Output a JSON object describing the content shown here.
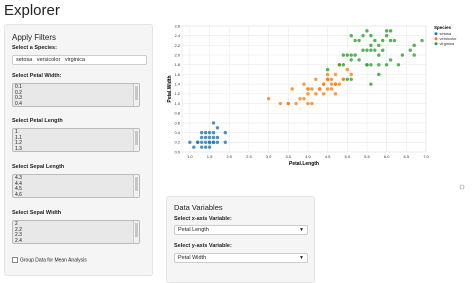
{
  "app": {
    "title": "Explorer"
  },
  "filters": {
    "heading": "Apply Filters",
    "species_label": "Select a Species:",
    "species_values": [
      "setosa",
      "versicolor",
      "virginica"
    ],
    "petal_width_label": "Select Petal Width:",
    "petal_width_options": [
      "0.1",
      "0.2",
      "0.3",
      "0.4"
    ],
    "petal_length_label": "Select Petal Length",
    "petal_length_options": [
      "1",
      "1.1",
      "1.2",
      "1.3"
    ],
    "sepal_length_label": "Select Sepal Length",
    "sepal_length_options": [
      "4.3",
      "4.4",
      "4.5",
      "4.6"
    ],
    "sepal_width_label": "Select Sepal Width",
    "sepal_width_options": [
      "2",
      "2.2",
      "2.3",
      "2.4"
    ],
    "group_checkbox_label": "Group Data for Mean Analysis"
  },
  "variables": {
    "heading": "Data Variables",
    "x_label": "Select x-axis Variable:",
    "x_value": "Petal Length",
    "y_label": "Select y-axis Variable:",
    "y_value": "Petal Width"
  },
  "colors": {
    "setosa": "#1f77b4",
    "versicolor": "#ff7f0e",
    "virginica": "#2ca02c"
  },
  "chart_data": {
    "type": "scatter",
    "xlabel": "Petal.Length",
    "ylabel": "Petal.Width",
    "xlim": [
      0.8,
      7.0
    ],
    "ylim": [
      0,
      2.6
    ],
    "x_ticks": [
      "1.0",
      "1.5",
      "2.0",
      "2.5",
      "3.0",
      "3.5",
      "4.0",
      "4.5",
      "5.0",
      "5.5",
      "6.0",
      "6.5",
      "7.0"
    ],
    "y_ticks": [
      "0.0",
      "0.2",
      "0.4",
      "0.6",
      "0.8",
      "1.0",
      "1.2",
      "1.4",
      "1.6",
      "1.8",
      "2.0",
      "2.2",
      "2.4",
      "2.6"
    ],
    "legend_title": "Species",
    "legend_position": "top-right",
    "series": [
      {
        "name": "setosa",
        "points": [
          [
            1.4,
            0.2
          ],
          [
            1.3,
            0.2
          ],
          [
            1.5,
            0.2
          ],
          [
            1.6,
            0.2
          ],
          [
            1.7,
            0.2
          ],
          [
            1.2,
            0.2
          ],
          [
            1.1,
            0.1
          ],
          [
            1.4,
            0.1
          ],
          [
            1.5,
            0.1
          ],
          [
            1.5,
            0.4
          ],
          [
            1.3,
            0.4
          ],
          [
            1.7,
            0.3
          ],
          [
            1.4,
            0.3
          ],
          [
            1.3,
            0.3
          ],
          [
            1.0,
            0.2
          ],
          [
            1.9,
            0.2
          ],
          [
            1.6,
            0.4
          ],
          [
            1.5,
            0.3
          ],
          [
            1.6,
            0.6
          ],
          [
            1.9,
            0.4
          ],
          [
            1.6,
            0.2
          ],
          [
            1.4,
            0.4
          ],
          [
            1.2,
            0.2
          ],
          [
            1.5,
            0.2
          ],
          [
            1.3,
            0.1
          ],
          [
            1.6,
            0.3
          ],
          [
            1.7,
            0.5
          ]
        ]
      },
      {
        "name": "versicolor",
        "points": [
          [
            4.7,
            1.4
          ],
          [
            4.5,
            1.5
          ],
          [
            4.9,
            1.5
          ],
          [
            4.0,
            1.3
          ],
          [
            4.6,
            1.5
          ],
          [
            4.5,
            1.3
          ],
          [
            4.7,
            1.6
          ],
          [
            3.3,
            1.0
          ],
          [
            4.6,
            1.3
          ],
          [
            3.9,
            1.4
          ],
          [
            3.5,
            1.0
          ],
          [
            4.2,
            1.5
          ],
          [
            4.0,
            1.0
          ],
          [
            4.7,
            1.4
          ],
          [
            3.6,
            1.3
          ],
          [
            4.4,
            1.4
          ],
          [
            4.5,
            1.5
          ],
          [
            4.1,
            1.0
          ],
          [
            4.5,
            1.5
          ],
          [
            3.9,
            1.1
          ],
          [
            4.8,
            1.8
          ],
          [
            4.0,
            1.3
          ],
          [
            4.9,
            1.5
          ],
          [
            4.7,
            1.2
          ],
          [
            4.3,
            1.3
          ],
          [
            4.4,
            1.4
          ],
          [
            4.8,
            1.4
          ],
          [
            5.0,
            1.7
          ],
          [
            3.8,
            1.1
          ],
          [
            3.7,
            1.0
          ],
          [
            5.1,
            1.6
          ],
          [
            4.5,
            1.6
          ],
          [
            4.1,
            1.3
          ],
          [
            3.0,
            1.1
          ],
          [
            4.2,
            1.2
          ],
          [
            4.4,
            1.2
          ],
          [
            4.6,
            1.4
          ],
          [
            4.0,
            1.2
          ],
          [
            3.5,
            1.0
          ],
          [
            4.3,
            1.3
          ]
        ]
      },
      {
        "name": "virginica",
        "points": [
          [
            6.0,
            2.5
          ],
          [
            5.1,
            1.9
          ],
          [
            5.9,
            2.1
          ],
          [
            5.6,
            1.8
          ],
          [
            5.8,
            2.2
          ],
          [
            6.6,
            2.1
          ],
          [
            4.5,
            1.7
          ],
          [
            6.3,
            1.8
          ],
          [
            6.1,
            2.5
          ],
          [
            5.1,
            2.0
          ],
          [
            5.3,
            1.9
          ],
          [
            5.5,
            2.1
          ],
          [
            5.0,
            2.0
          ],
          [
            5.1,
            2.4
          ],
          [
            5.3,
            2.3
          ],
          [
            5.5,
            1.8
          ],
          [
            6.7,
            2.2
          ],
          [
            6.9,
            2.3
          ],
          [
            5.0,
            1.5
          ],
          [
            5.7,
            2.3
          ],
          [
            4.9,
            2.0
          ],
          [
            6.7,
            2.0
          ],
          [
            4.9,
            1.8
          ],
          [
            5.7,
            2.1
          ],
          [
            6.0,
            1.8
          ],
          [
            4.8,
            1.8
          ],
          [
            5.6,
            2.1
          ],
          [
            5.8,
            1.6
          ],
          [
            6.1,
            1.9
          ],
          [
            6.4,
            2.0
          ],
          [
            5.6,
            2.2
          ],
          [
            5.1,
            1.5
          ],
          [
            5.6,
            1.4
          ],
          [
            6.1,
            2.3
          ],
          [
            5.6,
            2.4
          ],
          [
            5.5,
            1.8
          ],
          [
            5.4,
            2.1
          ],
          [
            5.2,
            2.3
          ],
          [
            5.4,
            2.4
          ],
          [
            5.8,
            1.8
          ],
          [
            6.0,
            2.4
          ],
          [
            5.2,
            2.0
          ],
          [
            5.8,
            2.0
          ],
          [
            6.2,
            2.3
          ],
          [
            5.9,
            2.3
          ],
          [
            5.5,
            2.5
          ]
        ]
      }
    ]
  }
}
